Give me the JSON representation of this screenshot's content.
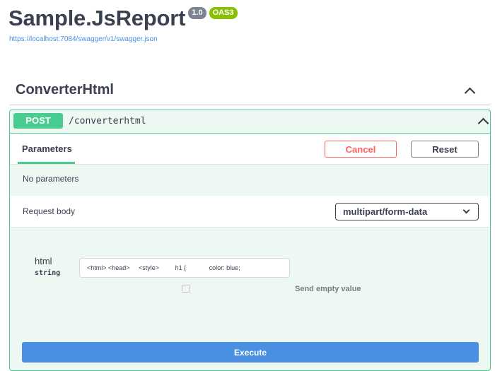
{
  "info": {
    "title": "Sample.JsReport",
    "version": "1.0",
    "oas_badge": "OAS3",
    "spec_url": "https://localhost:7084/swagger/v1/swagger.json"
  },
  "tag": {
    "name": "ConverterHtml",
    "expanded": true
  },
  "operation": {
    "method": "POST",
    "path": "/converterhtml",
    "method_color": "#49cc90",
    "parameters_tab": "Parameters",
    "cancel_label": "Cancel",
    "reset_label": "Reset",
    "no_params_text": "No parameters",
    "request_body_label": "Request body",
    "content_type": "multipart/form-data",
    "field": {
      "name": "html",
      "type": "string",
      "value": "<html> <head>     <style>         h1 {             color: blue;",
      "send_empty_label": "Send empty value"
    },
    "execute_label": "Execute"
  },
  "colors": {
    "link": "#4990e2",
    "cancel": "#ff6060",
    "execute": "#4990e2"
  }
}
